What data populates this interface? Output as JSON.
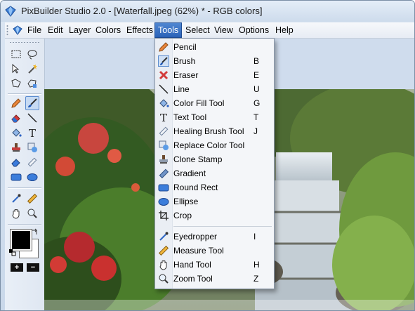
{
  "window": {
    "title": "PixBuilder Studio 2.0 - [Waterfall.jpeg (62%) * - RGB colors]"
  },
  "menubar": {
    "items": [
      "File",
      "Edit",
      "Layer",
      "Colors",
      "Effects",
      "Tools",
      "Select",
      "View",
      "Options",
      "Help"
    ],
    "active": "Tools"
  },
  "tools_menu": {
    "items": [
      {
        "label": "Pencil",
        "shortcut": "",
        "icon": "pencil-icon"
      },
      {
        "label": "Brush",
        "shortcut": "B",
        "icon": "brush-icon"
      },
      {
        "label": "Eraser",
        "shortcut": "E",
        "icon": "eraser-icon"
      },
      {
        "label": "Line",
        "shortcut": "U",
        "icon": "line-icon"
      },
      {
        "label": "Color Fill Tool",
        "shortcut": "G",
        "icon": "paint-bucket-icon"
      },
      {
        "label": "Text Tool",
        "shortcut": "T",
        "icon": "text-icon"
      },
      {
        "label": "Healing Brush Tool",
        "shortcut": "J",
        "icon": "healing-brush-icon"
      },
      {
        "label": "Replace Color Tool",
        "shortcut": "",
        "icon": "replace-color-icon"
      },
      {
        "label": "Clone Stamp",
        "shortcut": "",
        "icon": "clone-stamp-icon"
      },
      {
        "label": "Gradient",
        "shortcut": "",
        "icon": "gradient-icon"
      },
      {
        "label": "Round Rect",
        "shortcut": "",
        "icon": "round-rect-icon"
      },
      {
        "label": "Ellipse",
        "shortcut": "",
        "icon": "ellipse-icon"
      },
      {
        "label": "Crop",
        "shortcut": "",
        "icon": "crop-icon"
      },
      {
        "label": "Eyedropper",
        "shortcut": "I",
        "icon": "eyedropper-icon"
      },
      {
        "label": "Measure Tool",
        "shortcut": "",
        "icon": "measure-icon"
      },
      {
        "label": "Hand Tool",
        "shortcut": "H",
        "icon": "hand-icon"
      },
      {
        "label": "Zoom Tool",
        "shortcut": "Z",
        "icon": "zoom-icon"
      }
    ]
  },
  "toolpanel": {
    "selected_tool": "brush-tool",
    "foreground_color": "#000000",
    "background_color": "#ffffff",
    "add_label": "+",
    "remove_label": "−"
  },
  "colors": {
    "accent": "#2b63b8",
    "menu_bg": "#f4f6f9"
  }
}
